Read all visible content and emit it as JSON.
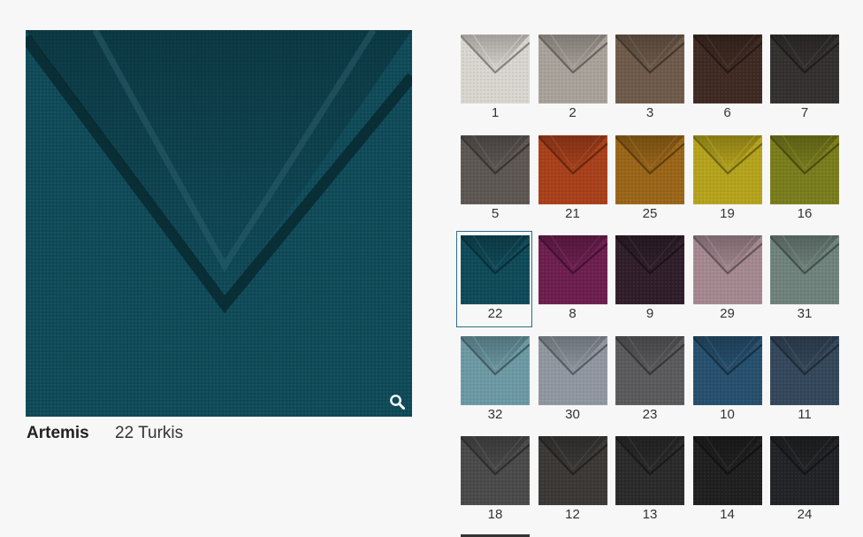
{
  "product": {
    "name": "Artemis",
    "variant": "22 Turkis",
    "selected_color": "#0f4a58"
  },
  "zoom_icon": "search-icon",
  "swatches": [
    {
      "number": "1",
      "color": "#d9d5cf"
    },
    {
      "number": "2",
      "color": "#a9a29a"
    },
    {
      "number": "3",
      "color": "#6e5a4a"
    },
    {
      "number": "6",
      "color": "#3f2a22"
    },
    {
      "number": "7",
      "color": "#33302e"
    },
    {
      "number": "5",
      "color": "#5d5753"
    },
    {
      "number": "21",
      "color": "#a8401a"
    },
    {
      "number": "25",
      "color": "#9a6518"
    },
    {
      "number": "19",
      "color": "#b5a31c"
    },
    {
      "number": "16",
      "color": "#7a7d1c"
    },
    {
      "number": "22",
      "color": "#0f4a58",
      "selected": true
    },
    {
      "number": "8",
      "color": "#6d1e4e"
    },
    {
      "number": "9",
      "color": "#2f1e2a"
    },
    {
      "number": "29",
      "color": "#a48891"
    },
    {
      "number": "31",
      "color": "#6f827c"
    },
    {
      "number": "32",
      "color": "#6c99a4"
    },
    {
      "number": "30",
      "color": "#8f97a0"
    },
    {
      "number": "23",
      "color": "#5a5a5d"
    },
    {
      "number": "10",
      "color": "#26506e"
    },
    {
      "number": "11",
      "color": "#34475a"
    },
    {
      "number": "18",
      "color": "#4a4a4a"
    },
    {
      "number": "12",
      "color": "#3b3836"
    },
    {
      "number": "13",
      "color": "#2a2a2a"
    },
    {
      "number": "14",
      "color": "#1f1f1f"
    },
    {
      "number": "24",
      "color": "#222326"
    }
  ]
}
